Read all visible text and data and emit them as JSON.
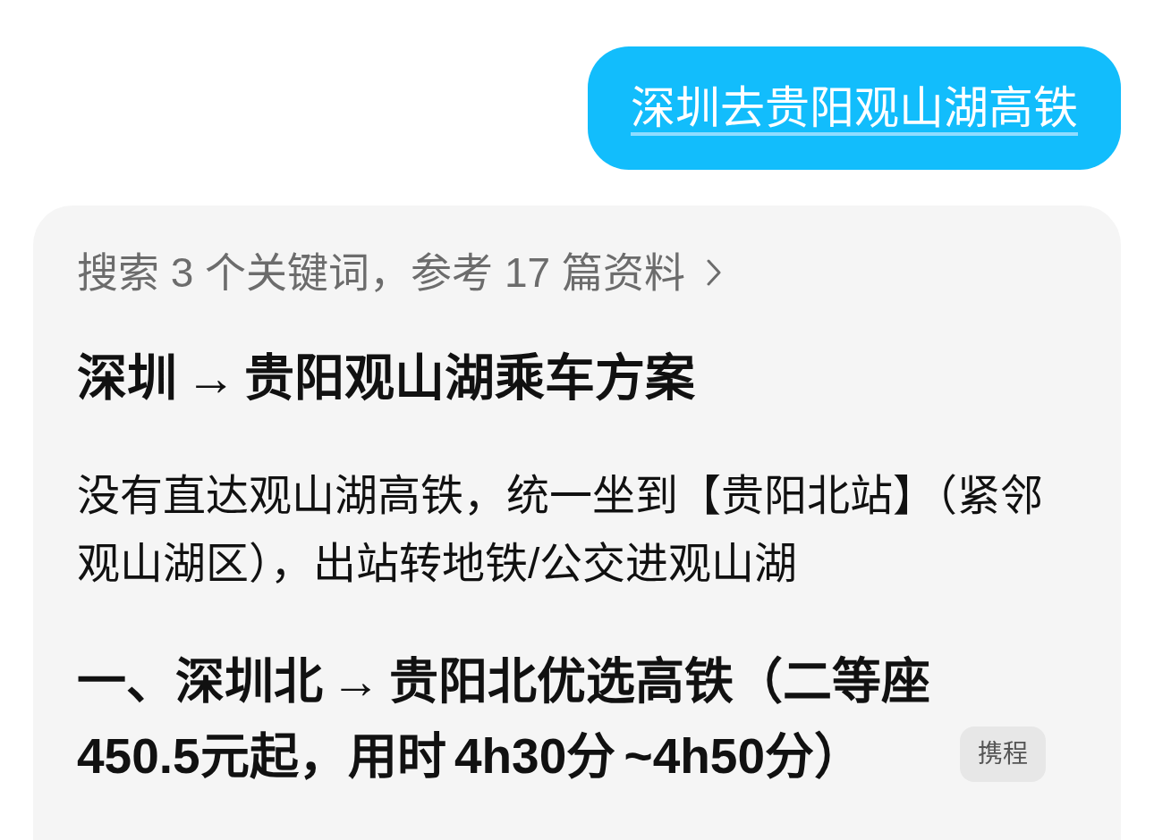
{
  "user_message": {
    "text": "深圳去贵阳观山湖高铁"
  },
  "response": {
    "search_summary": "搜索 3 个关键词，参考 17 篇资料",
    "title": "深圳 → 贵阳观山湖乘车方案",
    "intro": "没有直达观山湖高铁，统一坐到【贵阳北站】（紧邻观山湖区），出站转地铁/公交进观山湖",
    "sections": [
      {
        "heading": "一、深圳北 → 贵阳北优选高铁（二等座 450.5元起，用时 4h30分 ~4h50分）",
        "source": "携程"
      }
    ]
  }
}
